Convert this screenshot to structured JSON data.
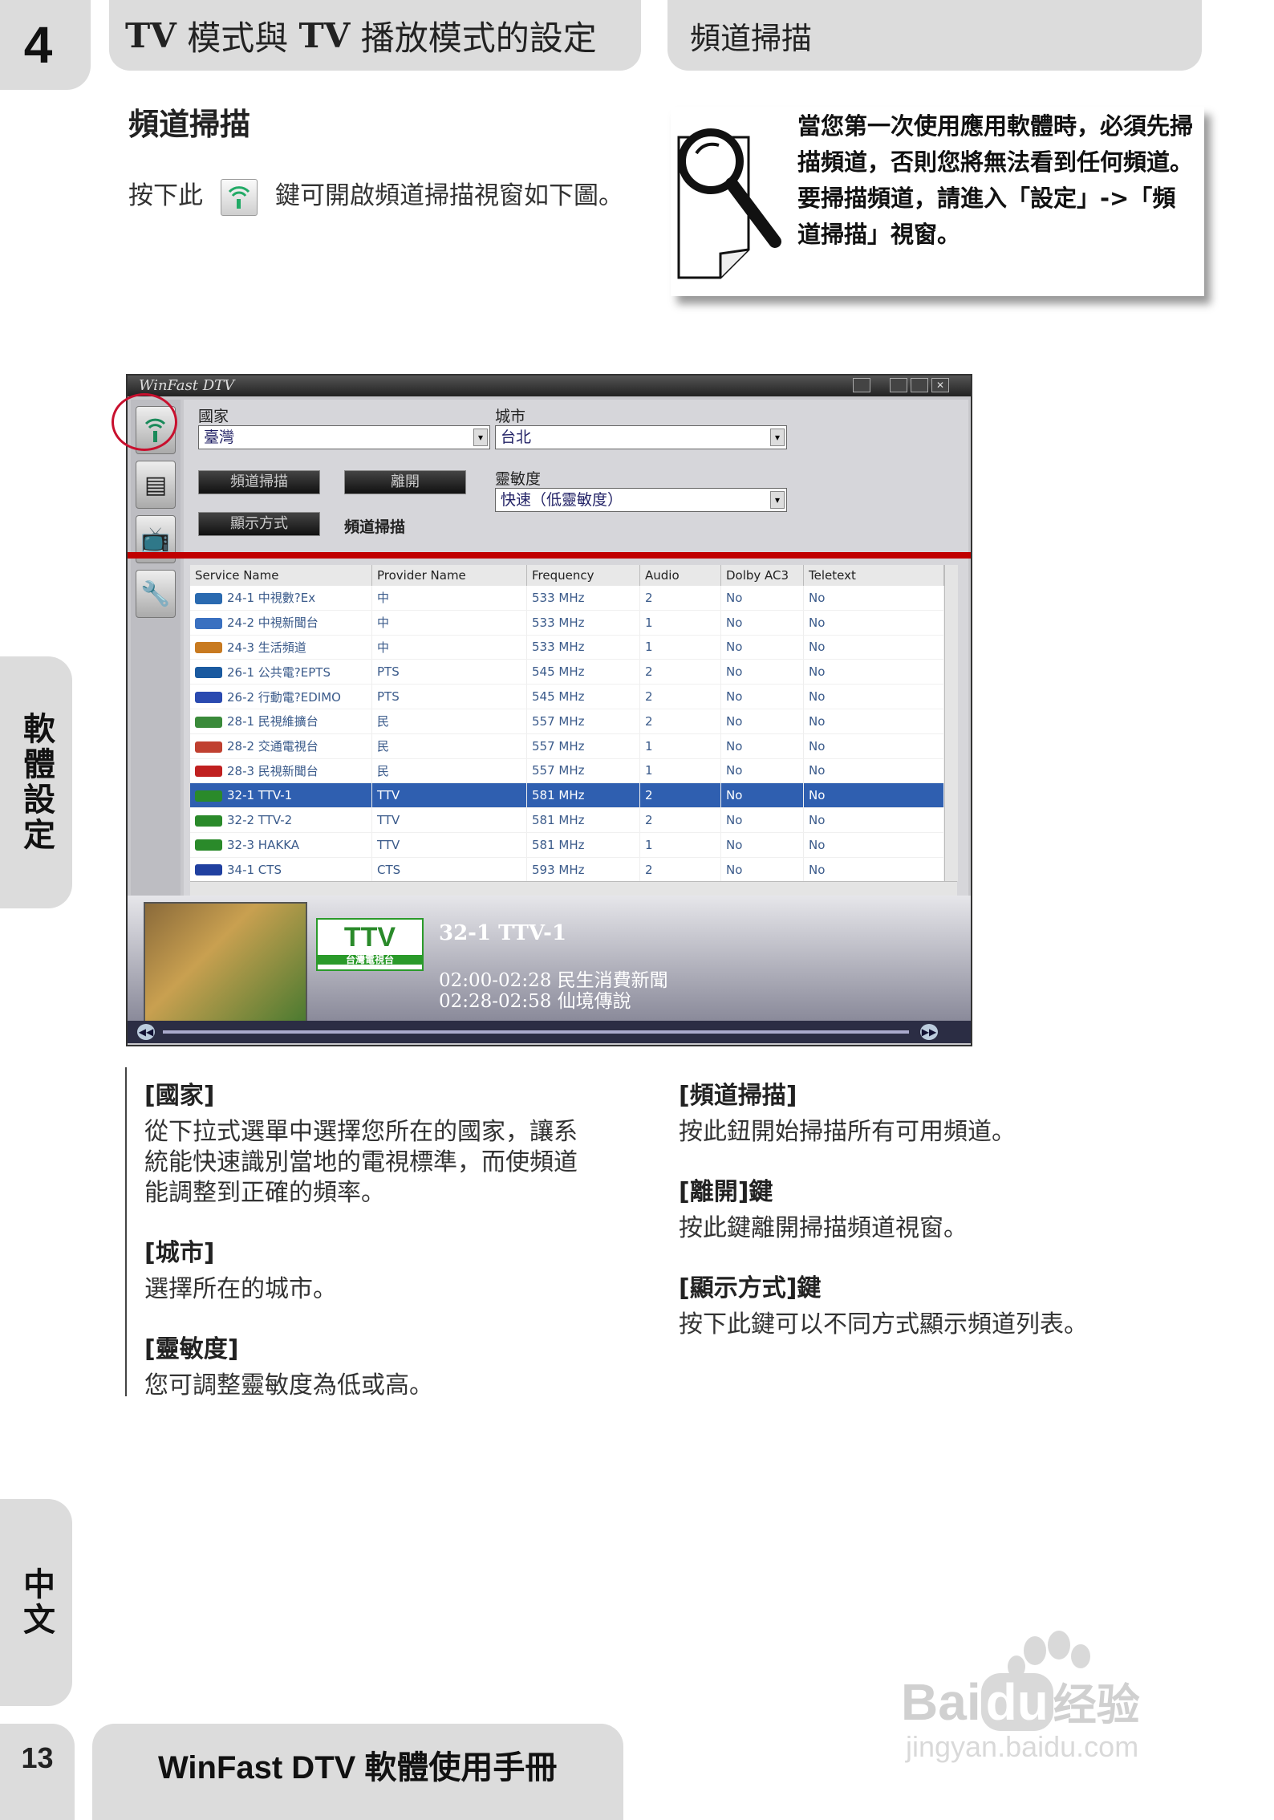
{
  "header": {
    "chapter_num": "4",
    "title_prefix": "TV",
    "title_mid": " 模式與 ",
    "title_prefix2": "TV",
    "title_rest": " 播放模式的設定",
    "section_label": "頻道掃描"
  },
  "side_tabs": {
    "upper": "軟體設定",
    "lower": "中文"
  },
  "section": {
    "heading": "頻道掃描",
    "intro_before": "按下此",
    "intro_after": "鍵可開啟頻道掃描視窗如下圖。"
  },
  "note": {
    "text": "當您第一次使用應用軟體時，必須先掃描頻道，否則您將無法看到任何頻道。要掃描頻道，請進入「設定」->「頻道掃描」視窗。"
  },
  "app": {
    "window_title": "WinFast DTV",
    "country_label": "國家",
    "country_value": "臺灣",
    "city_label": "城市",
    "city_value": "台北",
    "sensitivity_label": "靈敏度",
    "sensitivity_value": "快速（低靈敏度）",
    "scan_button": "頻道掃描",
    "exit_button": "離開",
    "display_button": "顯示方式",
    "panel_caption": "頻道掃描",
    "columns": [
      "Service Name",
      "Provider Name",
      "Frequency",
      "Audio",
      "Dolby AC3",
      "Teletext"
    ],
    "rows": [
      [
        "24-1 中視數?Ex",
        "中",
        "533 MHz",
        "2",
        "No",
        "No"
      ],
      [
        "24-2 中視新聞台",
        "中",
        "533 MHz",
        "1",
        "No",
        "No"
      ],
      [
        "24-3 生活頻道",
        "中",
        "533 MHz",
        "1",
        "No",
        "No"
      ],
      [
        "26-1 公共電?EPTS",
        "PTS",
        "545 MHz",
        "2",
        "No",
        "No"
      ],
      [
        "26-2 行動電?EDIMO",
        "PTS",
        "545 MHz",
        "2",
        "No",
        "No"
      ],
      [
        "28-1 民視維擴台",
        "民",
        "557 MHz",
        "2",
        "No",
        "No"
      ],
      [
        "28-2 交通電視台",
        "民",
        "557 MHz",
        "1",
        "No",
        "No"
      ],
      [
        "28-3 民視新聞台",
        "民",
        "557 MHz",
        "1",
        "No",
        "No"
      ],
      [
        "32-1 TTV-1",
        "TTV",
        "581 MHz",
        "2",
        "No",
        "No"
      ],
      [
        "32-2 TTV-2",
        "TTV",
        "581 MHz",
        "2",
        "No",
        "No"
      ],
      [
        "32-3 HAKKA",
        "TTV",
        "581 MHz",
        "1",
        "No",
        "No"
      ],
      [
        "34-1 CTS",
        "CTS",
        "593 MHz",
        "2",
        "No",
        "No"
      ]
    ],
    "selected_row": 8,
    "preview_logo": "TTV",
    "preview_logo_sub": "台灣電視台",
    "preview_channel": "32-1 TTV-1",
    "program_1": "02:00-02:28 民生消費新聞",
    "program_2": "02:28-02:58 仙境傳說"
  },
  "definitions_left": [
    {
      "term": "[國家]",
      "desc": "從下拉式選單中選擇您所在的國家，讓系統能快速識別當地的電視標準，而使頻道能調整到正確的頻率。"
    },
    {
      "term": "[城市]",
      "desc": "選擇所在的城市。"
    },
    {
      "term": "[靈敏度]",
      "desc": "您可調整靈敏度為低或高。"
    }
  ],
  "definitions_right": [
    {
      "term": "[頻道掃描]",
      "desc": "按此鈕開始掃描所有可用頻道。"
    },
    {
      "term": "[離開]鍵",
      "desc": "按此鍵離開掃描頻道視窗。"
    },
    {
      "term": "[顯示方式]鍵",
      "desc": "按下此鍵可以不同方式顯示頻道列表。"
    }
  ],
  "footer": {
    "page_number": "13",
    "manual_title": "WinFast DTV 軟體使用手冊"
  },
  "watermark": {
    "brand": "Bai",
    "brand2": "du",
    "brand_cn": "经验",
    "url": "jingyan.baidu.com"
  },
  "colors": {
    "tab_gray": "#dcdcdc",
    "accent_red": "#c8102e",
    "selection_blue": "#2f5fb0"
  }
}
